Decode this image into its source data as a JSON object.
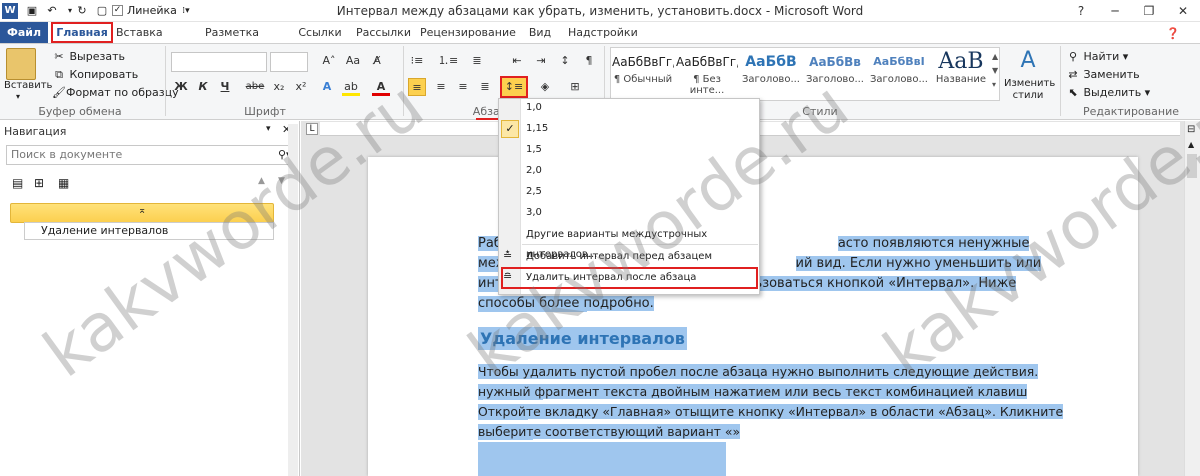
{
  "window": {
    "title": "Интервал между абзацами как убрать, изменить, установить.docx - Microsoft Word",
    "ruler_checkbox_label": "Линейка",
    "help": "?"
  },
  "tabs": [
    "Файл",
    "Главная",
    "Вставка",
    "Разметка страницы",
    "Ссылки",
    "Рассылки",
    "Рецензирование",
    "Вид",
    "Надстройки"
  ],
  "ribbon": {
    "clipboard": {
      "paste": "Вставить",
      "cut": "Вырезать",
      "copy": "Копировать",
      "format_painter": "Формат по образцу",
      "group": "Буфер обмена"
    },
    "font": {
      "group": "Шрифт",
      "bold": "Ж",
      "italic": "К",
      "underline": "Ч",
      "strike": "abe",
      "sub": "x₂",
      "sup": "x²",
      "aa": "Аа"
    },
    "paragraph": {
      "group": "Абзац"
    },
    "styles": {
      "group": "Стили",
      "change": "Изменить стили",
      "items": [
        {
          "sample": "АаБбВвГг,",
          "name": "¶ Обычный"
        },
        {
          "sample": "АаБбВвГг,",
          "name": "¶ Без инте..."
        },
        {
          "sample": "АаБбВ",
          "name": "Заголово..."
        },
        {
          "sample": "АаБбВв",
          "name": "Заголово..."
        },
        {
          "sample": "АаБбВвI",
          "name": "Заголово..."
        },
        {
          "sample": "AaB",
          "name": "Название"
        }
      ]
    },
    "editing": {
      "group": "Редактирование",
      "find": "Найти",
      "replace": "Заменить",
      "select": "Выделить"
    }
  },
  "nav": {
    "title": "Навигация",
    "search_placeholder": "Поиск в документе",
    "item": "Удаление интервалов"
  },
  "dropdown": {
    "values": [
      "1,0",
      "1,15",
      "1,5",
      "2,0",
      "2,5",
      "3,0"
    ],
    "checked": "1,15",
    "other": "Другие варианты междустрочных интервалов...",
    "add_before": "Добавить интервал перед абзацем",
    "remove_after": "Удалить интервал после абзаца"
  },
  "document": {
    "p1_line1_a": "Раб",
    "p1_line1_b": "асто появляются ненужные пустые промежутки",
    "p1_line2_a": "меж",
    "p1_line2_b": "ий вид. Если нужно уменьшить или вовсе убрать",
    "p1_line3_a": "инт",
    "p1_line3_b": "ьзоваться кнопкой «Интервал». Ниже рассмотрим все",
    "p1_line4": "способы более подробно.",
    "heading": "Удаление интервалов",
    "p2_line1": "Чтобы удалить пустой пробел после абзаца нужно выполнить следующие действия. Выделите",
    "p2_line2": "нужный фрагмент текста двойным нажатием или весь текст комбинацией клавиш «CtrlA».",
    "p2_line3": "Откройте вкладку «Главная» отыщите кнопку «Интервал» в области «Абзац». Кликните по ней и",
    "p2_line4": "выберите соответствующий вариант «»"
  },
  "watermark": "kakvworde.ru",
  "colors": {
    "accent": "#2b579a",
    "highlight": "#9fc6ee",
    "red_frame": "#e02020",
    "heading": "#2e74b5"
  }
}
